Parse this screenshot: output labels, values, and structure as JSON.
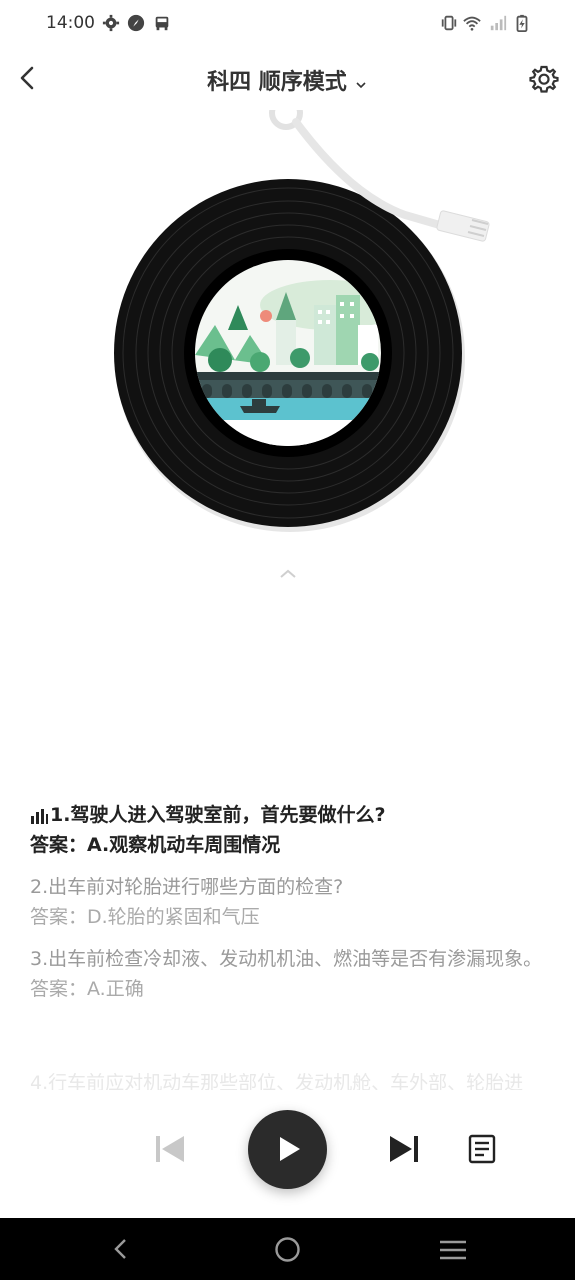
{
  "status_bar": {
    "time": "14:00",
    "icons": [
      "gear-icon",
      "compass-icon",
      "car-icon",
      "vibrate-icon",
      "wifi-icon",
      "signal-icon",
      "battery-charging-icon"
    ]
  },
  "header": {
    "title": "科四 顺序模式",
    "icons": [
      "back-arrow-icon",
      "chevron-down-icon",
      "settings-gear-icon"
    ]
  },
  "player": {
    "artwork": "vinyl-record-city-illustration",
    "icons": [
      "previous-icon",
      "play-icon",
      "next-icon",
      "playlist-icon"
    ]
  },
  "questions": [
    {
      "question": "1.驾驶人进入驾驶室前，首先要做什么?",
      "answer": "答案：A.观察机动车周围情况",
      "state": "active"
    },
    {
      "question": "2.出车前对轮胎进行哪些方面的检查?",
      "answer": "答案：D.轮胎的紧固和气压",
      "state": "inactive"
    },
    {
      "question": "3.出车前检查冷却液、发动机机油、燃油等是否有渗漏现象。",
      "answer": "答案：A.正确",
      "state": "inactive"
    }
  ],
  "fade_text": "4.行车前应对机动车那些部位、发动机舱、车外部、轮胎进",
  "colors": {
    "accent_dark": "#2b2b2b",
    "text_active": "#222222",
    "text_inactive": "#9a9a9a",
    "nav_bar": "#000000"
  }
}
